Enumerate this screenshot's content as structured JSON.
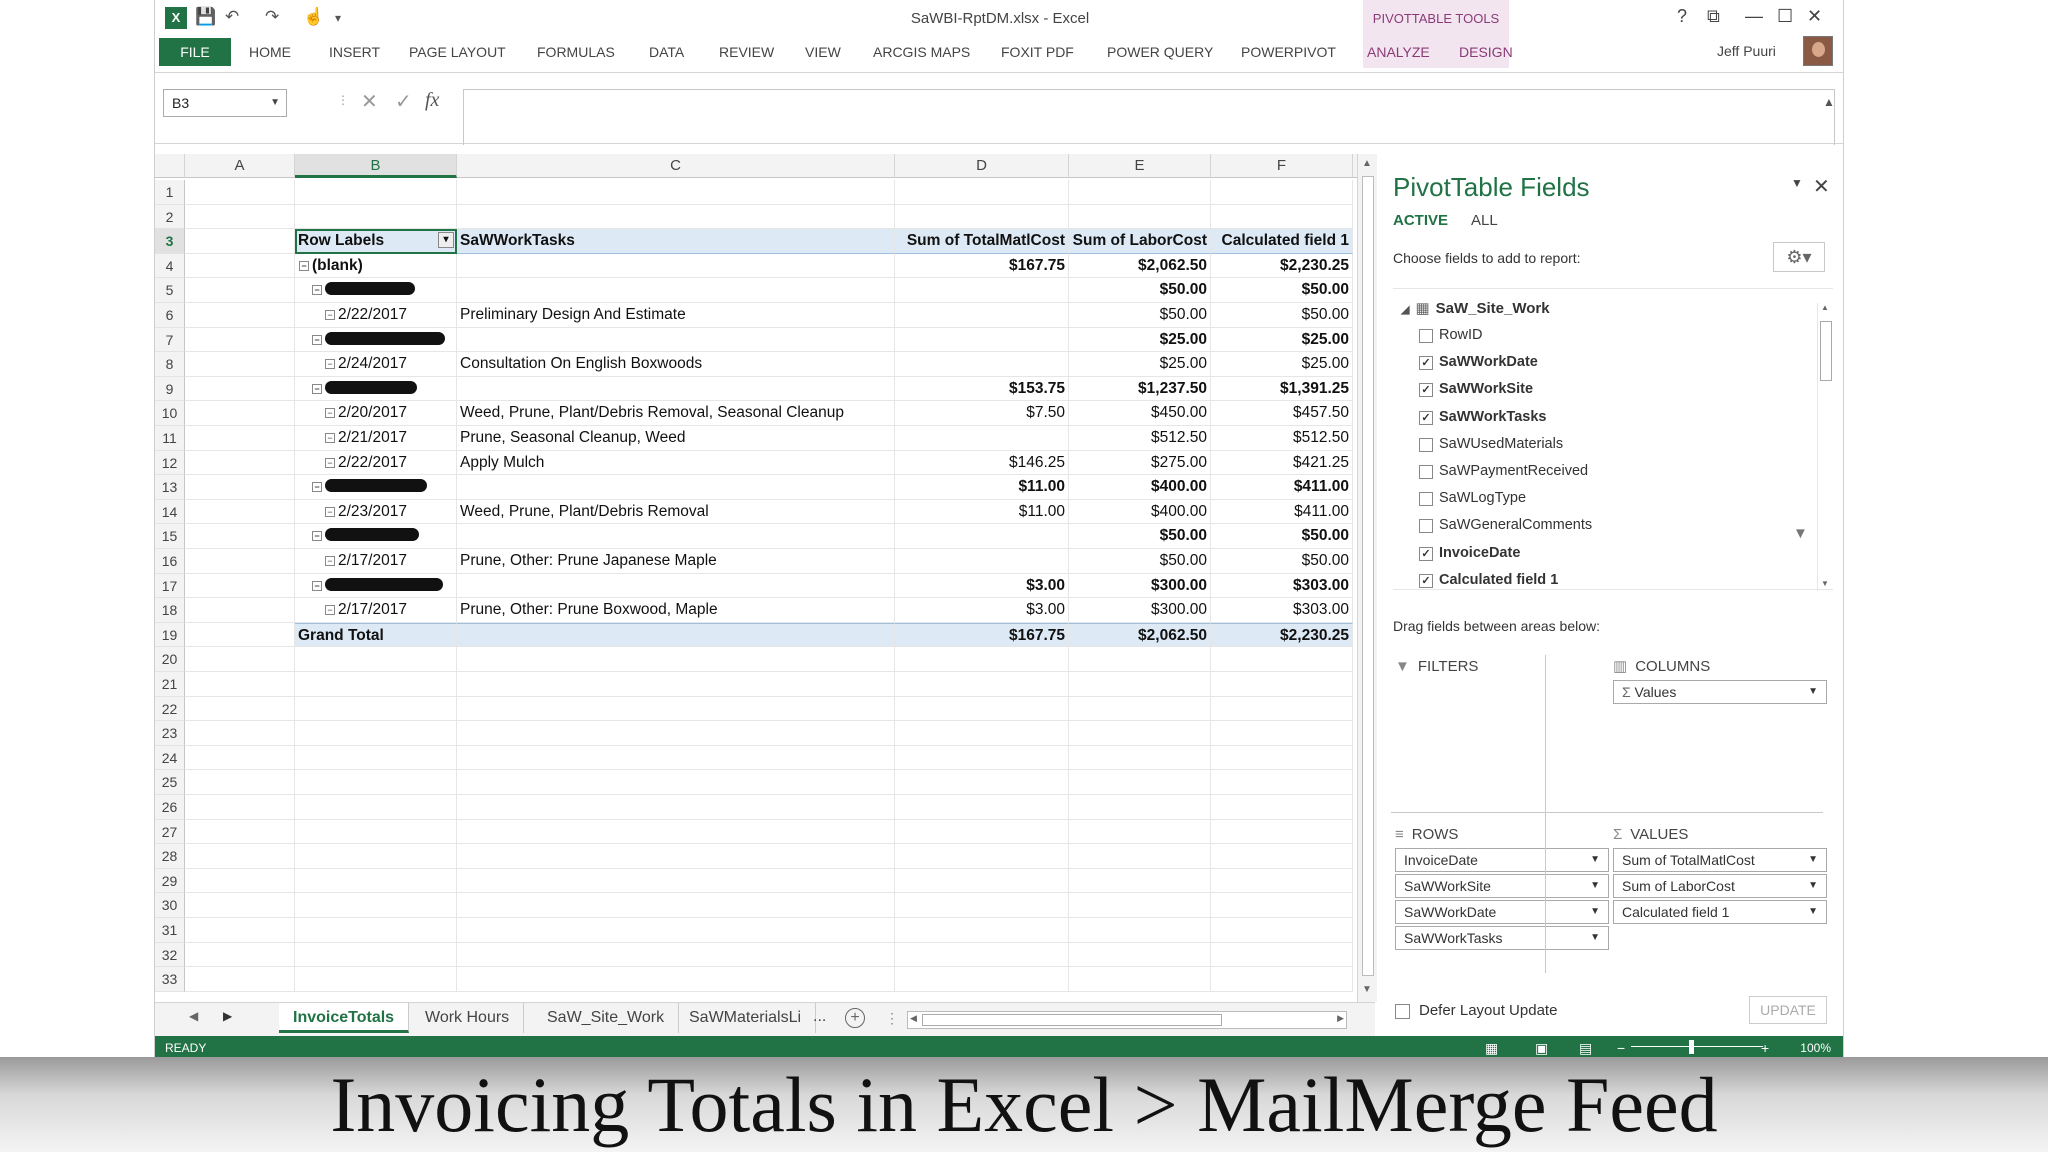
{
  "window": {
    "title": "SaWBI-RptDM.xlsx - Excel",
    "context_tools": "PIVOTTABLE TOOLS",
    "user": "Jeff Puuri",
    "controls": [
      "?",
      "⧉",
      "—",
      "☐",
      "✕"
    ]
  },
  "ribbon": {
    "file_tab": "FILE",
    "tabs": [
      "HOME",
      "INSERT",
      "PAGE LAYOUT",
      "FORMULAS",
      "DATA",
      "REVIEW",
      "VIEW",
      "ARCGIS MAPS",
      "FOXIT PDF",
      "POWER QUERY",
      "POWERPIVOT"
    ],
    "context_tabs": [
      "ANALYZE",
      "DESIGN"
    ]
  },
  "formula_bar": {
    "name_box": "B3",
    "cancel": "✕",
    "enter": "✓",
    "fx": "fx",
    "value": ""
  },
  "columns": [
    "A",
    "B",
    "C",
    "D",
    "E",
    "F"
  ],
  "selected_column": "B",
  "selected_row": 3,
  "row_numbers": [
    1,
    2,
    3,
    4,
    5,
    6,
    7,
    8,
    9,
    10,
    11,
    12,
    13,
    14,
    15,
    16,
    17,
    18,
    19,
    20,
    21,
    22,
    23,
    24,
    25,
    26,
    27,
    28,
    29,
    30,
    31,
    32,
    33
  ],
  "pivot": {
    "headers": [
      "Row Labels",
      "SaWWorkTasks",
      "Sum of TotalMatlCost",
      "Sum of LaborCost",
      "Calculated field 1"
    ],
    "rows": [
      {
        "row": 4,
        "level": 0,
        "label": "(blank)",
        "task": "",
        "matl": "$167.75",
        "labor": "$2,062.50",
        "calc": "$2,230.25",
        "bold": true,
        "redacted": false
      },
      {
        "row": 5,
        "level": 1,
        "label": "",
        "task": "",
        "matl": "",
        "labor": "$50.00",
        "calc": "$50.00",
        "bold": true,
        "redacted": true,
        "scribble": 90
      },
      {
        "row": 6,
        "level": 2,
        "label": "2/22/2017",
        "task": "Preliminary Design And Estimate",
        "matl": "",
        "labor": "$50.00",
        "calc": "$50.00",
        "bold": false,
        "redacted": false
      },
      {
        "row": 7,
        "level": 1,
        "label": "",
        "task": "",
        "matl": "",
        "labor": "$25.00",
        "calc": "$25.00",
        "bold": true,
        "redacted": true,
        "scribble": 120
      },
      {
        "row": 8,
        "level": 2,
        "label": "2/24/2017",
        "task": "Consultation On English Boxwoods",
        "matl": "",
        "labor": "$25.00",
        "calc": "$25.00",
        "bold": false,
        "redacted": false
      },
      {
        "row": 9,
        "level": 1,
        "label": "",
        "task": "",
        "matl": "$153.75",
        "labor": "$1,237.50",
        "calc": "$1,391.25",
        "bold": true,
        "redacted": true,
        "scribble": 92
      },
      {
        "row": 10,
        "level": 2,
        "label": "2/20/2017",
        "task": "Weed, Prune, Plant/Debris Removal, Seasonal Cleanup",
        "matl": "$7.50",
        "labor": "$450.00",
        "calc": "$457.50",
        "bold": false,
        "redacted": false
      },
      {
        "row": 11,
        "level": 2,
        "label": "2/21/2017",
        "task": "Prune, Seasonal Cleanup, Weed",
        "matl": "",
        "labor": "$512.50",
        "calc": "$512.50",
        "bold": false,
        "redacted": false
      },
      {
        "row": 12,
        "level": 2,
        "label": "2/22/2017",
        "task": "Apply Mulch",
        "matl": "$146.25",
        "labor": "$275.00",
        "calc": "$421.25",
        "bold": false,
        "redacted": false
      },
      {
        "row": 13,
        "level": 1,
        "label": "",
        "task": "",
        "matl": "$11.00",
        "labor": "$400.00",
        "calc": "$411.00",
        "bold": true,
        "redacted": true,
        "scribble": 102
      },
      {
        "row": 14,
        "level": 2,
        "label": "2/23/2017",
        "task": "Weed, Prune, Plant/Debris Removal",
        "matl": "$11.00",
        "labor": "$400.00",
        "calc": "$411.00",
        "bold": false,
        "redacted": false
      },
      {
        "row": 15,
        "level": 1,
        "label": "",
        "task": "",
        "matl": "",
        "labor": "$50.00",
        "calc": "$50.00",
        "bold": true,
        "redacted": true,
        "scribble": 94
      },
      {
        "row": 16,
        "level": 2,
        "label": "2/17/2017",
        "task": "Prune, Other: Prune Japanese Maple",
        "matl": "",
        "labor": "$50.00",
        "calc": "$50.00",
        "bold": false,
        "redacted": false
      },
      {
        "row": 17,
        "level": 1,
        "label": "",
        "task": "",
        "matl": "$3.00",
        "labor": "$300.00",
        "calc": "$303.00",
        "bold": true,
        "redacted": true,
        "scribble": 118
      },
      {
        "row": 18,
        "level": 2,
        "label": "2/17/2017",
        "task": "Prune, Other: Prune Boxwood, Maple",
        "matl": "$3.00",
        "labor": "$300.00",
        "calc": "$303.00",
        "bold": false,
        "redacted": false
      }
    ],
    "grand_total": {
      "label": "Grand Total",
      "matl": "$167.75",
      "labor": "$2,062.50",
      "calc": "$2,230.25"
    }
  },
  "sheets": {
    "tabs": [
      "InvoiceTotals",
      "Work Hours",
      "SaW_Site_Work",
      "SaWMaterialsLi"
    ],
    "active": "InvoiceTotals",
    "more": "...",
    "add": "+"
  },
  "status": {
    "ready": "READY",
    "zoom": "100%"
  },
  "pane": {
    "title": "PivotTable Fields",
    "tabs": [
      "ACTIVE",
      "ALL"
    ],
    "choose": "Choose fields to add to report:",
    "table": "SaW_Site_Work",
    "fields": [
      {
        "name": "RowID",
        "checked": false
      },
      {
        "name": "SaWWorkDate",
        "checked": true
      },
      {
        "name": "SaWWorkSite",
        "checked": true
      },
      {
        "name": "SaWWorkTasks",
        "checked": true
      },
      {
        "name": "SaWUsedMaterials",
        "checked": false
      },
      {
        "name": "SaWPaymentReceived",
        "checked": false
      },
      {
        "name": "SaWLogType",
        "checked": false
      },
      {
        "name": "SaWGeneralComments",
        "checked": false
      },
      {
        "name": "InvoiceDate",
        "checked": true
      },
      {
        "name": "Calculated field 1",
        "checked": true
      }
    ],
    "drag_hint": "Drag fields between areas below:",
    "filters_title": "FILTERS",
    "columns_title": "COLUMNS",
    "columns_items": [
      "Values"
    ],
    "rows_title": "ROWS",
    "rows_items": [
      "InvoiceDate",
      "SaWWorkSite",
      "SaWWorkDate",
      "SaWWorkTasks"
    ],
    "values_title": "VALUES",
    "values_items": [
      "Sum of TotalMatlCost",
      "Sum of LaborCost",
      "Calculated field 1"
    ],
    "defer": "Defer Layout Update",
    "update": "UPDATE"
  },
  "caption": "Invoicing Totals in Excel > MailMerge Feed"
}
